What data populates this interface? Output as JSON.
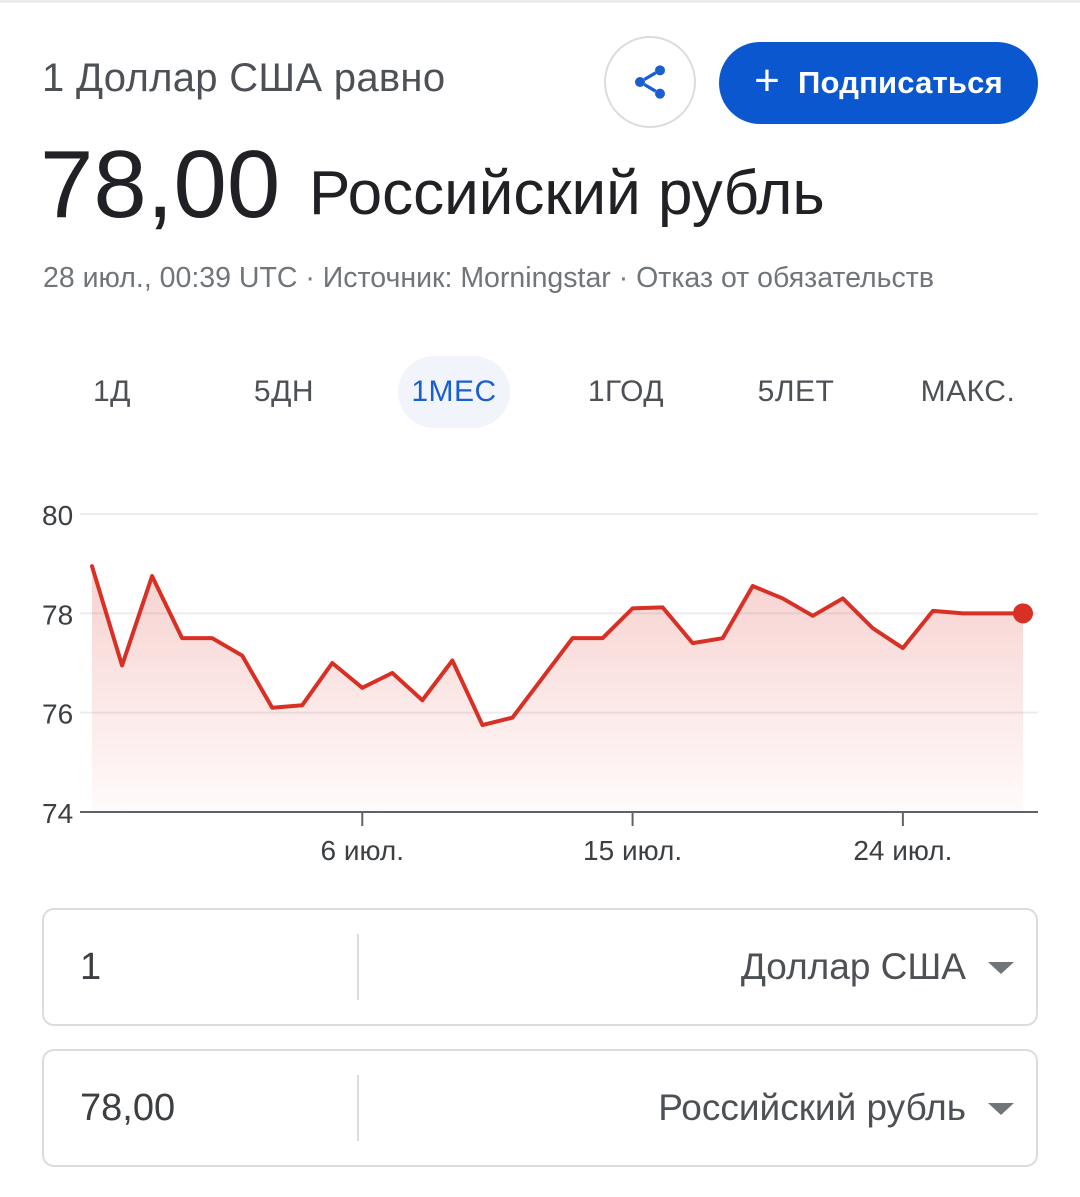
{
  "header": {
    "subtitle": "1 Доллар США равно",
    "value": "78,00",
    "currency": "Российский рубль",
    "meta": "28 июл., 00:39 UTC · Источник: Morningstar · Отказ от обязательств",
    "share_icon": "share-icon",
    "subscribe_plus": "+",
    "subscribe_label": "Подписаться",
    "accent_color": "#0b57d0"
  },
  "tabs": [
    {
      "label": "1Д",
      "active": false
    },
    {
      "label": "5ДН",
      "active": false
    },
    {
      "label": "1МЕС",
      "active": true
    },
    {
      "label": "1ГОД",
      "active": false
    },
    {
      "label": "5ЛЕТ",
      "active": false
    },
    {
      "label": "МАКС.",
      "active": false
    }
  ],
  "chart_data": {
    "type": "area",
    "title": "",
    "xlabel": "",
    "ylabel": "",
    "ylim": [
      74,
      80
    ],
    "yticks": [
      "80",
      "78",
      "76",
      "74"
    ],
    "xticks": [
      "6 июл.",
      "15 июл.",
      "24 июл."
    ],
    "grid": true,
    "color": "#d93025",
    "series": [
      {
        "x": [
          "27 июн.",
          "28 июн.",
          "29 июн.",
          "30 июн.",
          "1 июл.",
          "2 июл.",
          "3 июл.",
          "4 июл.",
          "5 июл.",
          "6 июл.",
          "7 июл.",
          "8 июл.",
          "9 июл.",
          "10 июл.",
          "11 июл.",
          "12 июл.",
          "13 июл.",
          "14 июл.",
          "15 июл.",
          "16 июл.",
          "17 июл.",
          "18 июл.",
          "19 июл.",
          "20 июл.",
          "21 июл.",
          "22 июл.",
          "23 июл.",
          "24 июл.",
          "25 июл.",
          "26 июл.",
          "27 июл.",
          "28 июл."
        ],
        "values": [
          78.95,
          76.95,
          78.75,
          77.5,
          77.5,
          77.15,
          76.1,
          76.15,
          77.0,
          76.5,
          76.8,
          76.25,
          77.05,
          75.75,
          75.9,
          76.7,
          77.5,
          77.5,
          78.1,
          78.12,
          77.4,
          77.5,
          78.55,
          78.3,
          77.95,
          78.3,
          77.7,
          77.3,
          78.05,
          78.0,
          78.0,
          78.0
        ]
      }
    ]
  },
  "converter": {
    "from": {
      "amount": "1",
      "currency": "Доллар США"
    },
    "to": {
      "amount": "78,00",
      "currency": "Российский рубль"
    }
  }
}
